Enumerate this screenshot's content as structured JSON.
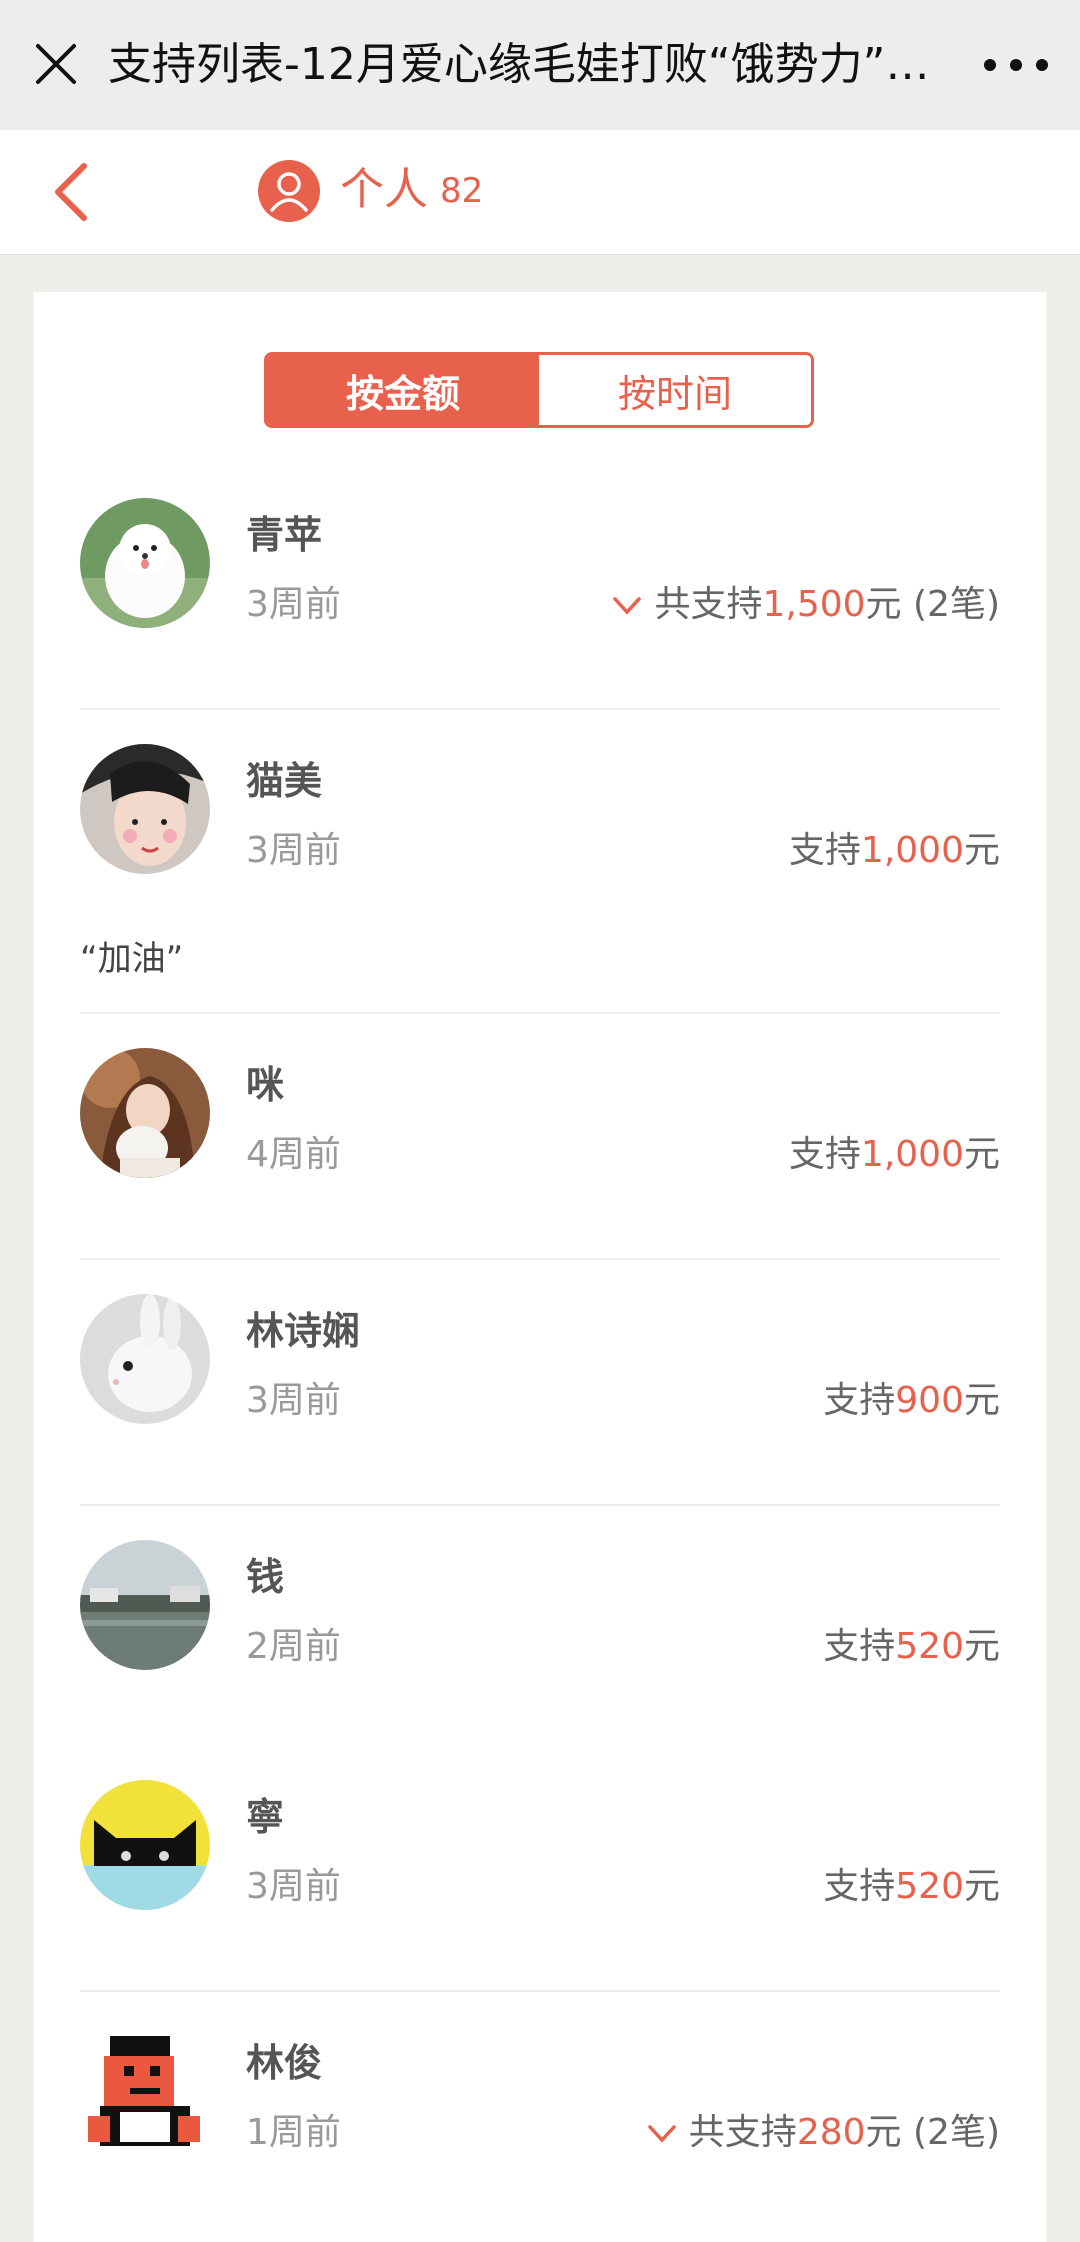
{
  "window": {
    "title": "支持列表-12月爱心缘毛娃打败“饿势力”行...",
    "close_icon": "close-icon",
    "more_icon": "more-icon"
  },
  "nav": {
    "label": "个人",
    "count": "82",
    "accent_color": "#e8614d"
  },
  "sort_tabs": {
    "by_amount": "按金额",
    "by_time": "按时间",
    "selected": "按金额"
  },
  "supporters": [
    {
      "name": "青苹",
      "time": "3周前",
      "prefix": "共支持",
      "amount": "1,500",
      "unit": "元",
      "suffix": " (2笔)",
      "expandable": true
    },
    {
      "name": "猫美",
      "time": "3周前",
      "prefix": "支持",
      "amount": "1,000",
      "unit": "元",
      "suffix": "",
      "message": "“加油”"
    },
    {
      "name": "咪",
      "time": "4周前",
      "prefix": "支持",
      "amount": "1,000",
      "unit": "元",
      "suffix": ""
    },
    {
      "name": "林诗娴",
      "time": "3周前",
      "prefix": "支持",
      "amount": "900",
      "unit": "元",
      "suffix": ""
    },
    {
      "name": "钱",
      "time": "2周前",
      "prefix": "支持",
      "amount": "520",
      "unit": "元",
      "suffix": ""
    },
    {
      "name": "寧",
      "time": "3周前",
      "prefix": "支持",
      "amount": "520",
      "unit": "元",
      "suffix": ""
    },
    {
      "name": "林俊",
      "time": "1周前",
      "prefix": "共支持",
      "amount": "280",
      "unit": "元",
      "suffix": " (2笔)",
      "expandable": true
    }
  ]
}
